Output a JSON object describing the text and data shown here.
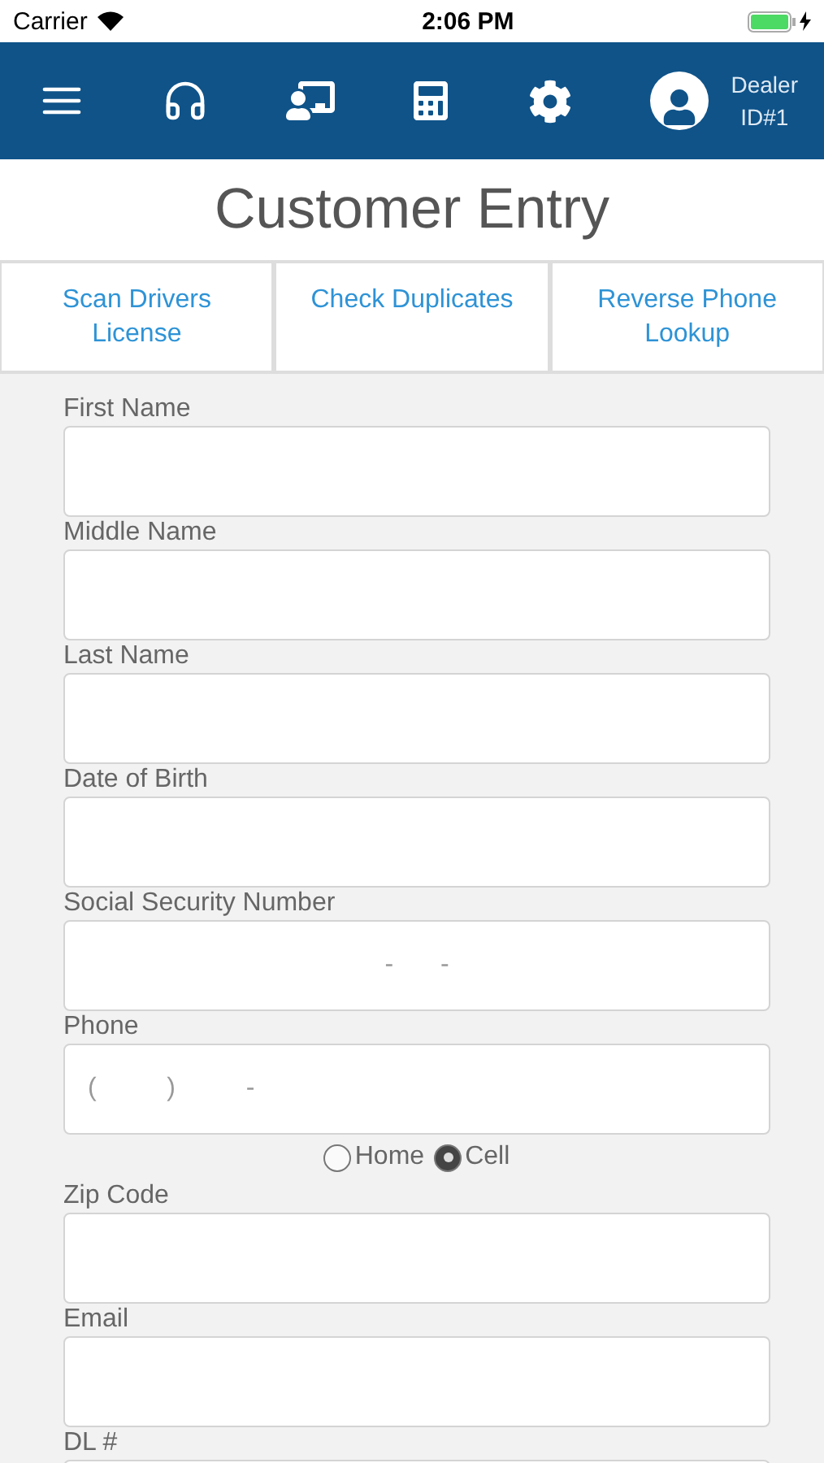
{
  "status_bar": {
    "carrier": "Carrier",
    "time": "2:06 PM",
    "charging": true
  },
  "nav": {
    "user": "Dealer\nID#1"
  },
  "title": "Customer Entry",
  "actions": [
    "Scan Drivers\nLicense",
    "Check Duplicates",
    "Reverse Phone\nLookup"
  ],
  "fields": [
    {
      "label": "First Name",
      "kind": "text"
    },
    {
      "label": "Middle Name",
      "kind": "text"
    },
    {
      "label": "Last Name",
      "kind": "text"
    },
    {
      "label": "Date of Birth",
      "kind": "text"
    },
    {
      "label": "Social Security Number",
      "kind": "masked-center",
      "placeholder": "-  -"
    },
    {
      "label": "Phone",
      "kind": "masked-left",
      "placeholder": "(   )   -",
      "options": [
        {
          "label": "Home",
          "selected": false
        },
        {
          "label": "Cell",
          "selected": true
        }
      ]
    },
    {
      "label": "Zip Code",
      "kind": "text"
    },
    {
      "label": "Email",
      "kind": "text"
    },
    {
      "label": "DL #",
      "kind": "text"
    }
  ]
}
